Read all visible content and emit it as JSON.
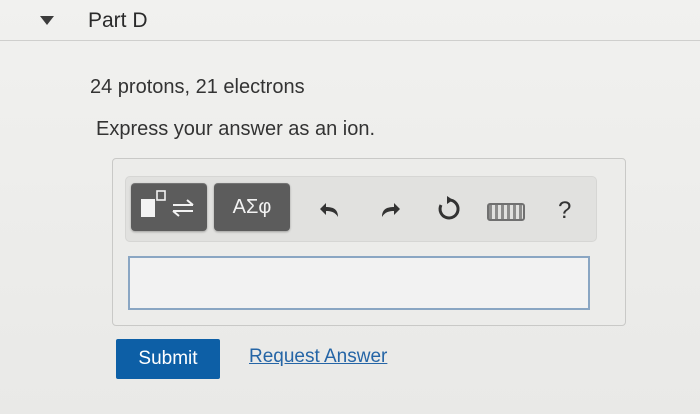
{
  "part": {
    "title": "Part D"
  },
  "question": {
    "text": "24 protons, 21 electrons",
    "instruction": "Express your answer as an ion."
  },
  "toolbar": {
    "template_icon": "templates-icon",
    "symbols_label": "ΑΣφ",
    "undo_icon": "undo-icon",
    "redo_icon": "redo-icon",
    "reset_icon": "reset-icon",
    "keyboard_icon": "keyboard-icon",
    "help_label": "?"
  },
  "actions": {
    "submit_label": "Submit",
    "request_answer_label": "Request Answer"
  },
  "colors": {
    "submit_bg": "#0d5fa6",
    "link": "#2565a6",
    "tool_button": "#5c5c5c"
  }
}
